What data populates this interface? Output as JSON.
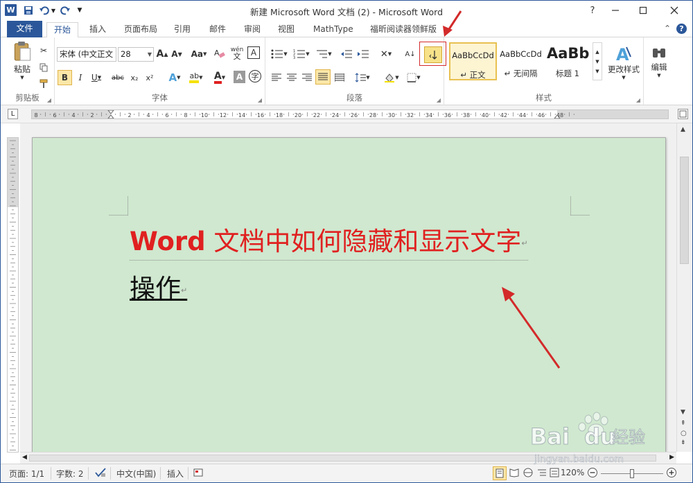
{
  "window": {
    "title": "新建 Microsoft Word 文档 (2)  -  Microsoft Word",
    "app_icon": "W"
  },
  "ribbon_tabs": [
    {
      "label": "文件"
    },
    {
      "label": "开始"
    },
    {
      "label": "插入"
    },
    {
      "label": "页面布局"
    },
    {
      "label": "引用"
    },
    {
      "label": "邮件"
    },
    {
      "label": "审阅"
    },
    {
      "label": "视图"
    },
    {
      "label": "MathType"
    },
    {
      "label": "福昕阅读器领鲜版"
    }
  ],
  "groups": {
    "clipboard": {
      "label": "剪贴板",
      "paste": "粘贴"
    },
    "font": {
      "label": "字体",
      "font_name": "宋体 (中文正文",
      "font_size": "28",
      "bold": "B",
      "italic": "I",
      "underline": "U",
      "strike": "abc",
      "subscript": "x₂",
      "superscript": "x²",
      "grow": "A",
      "shrink": "A",
      "change_case": "Aa",
      "wen": "文",
      "phonetic": "wén",
      "border_char": "A",
      "font_color": "A",
      "char_shade": "A",
      "enclose": "字"
    },
    "paragraph": {
      "label": "段落"
    },
    "styles": {
      "label": "样式",
      "items": [
        {
          "sample": "AaBbCcDd",
          "name": "↵ 正文"
        },
        {
          "sample": "AaBbCcDd",
          "name": "↵ 无间隔"
        },
        {
          "sample": "AaBb",
          "name": "标题 1"
        }
      ],
      "change_styles": "更改样式"
    },
    "editing": {
      "label": "编辑"
    }
  },
  "document": {
    "line1_word": "Word",
    "line1_rest": " 文档中如何隐藏和显示文字",
    "line2": "操作",
    "paragraph_mark": "↵"
  },
  "ruler_numbers": [
    "8",
    "6",
    "4",
    "2",
    "",
    "2",
    "4",
    "6",
    "8",
    "10",
    "12",
    "14",
    "16",
    "18",
    "20",
    "22",
    "24",
    "26",
    "28",
    "30",
    "32",
    "34",
    "36",
    "38",
    "40",
    "42",
    "44",
    "46",
    "48"
  ],
  "status": {
    "page": "页面: 1/1",
    "words": "字数: 2",
    "language": "中文(中国)",
    "mode": "插入",
    "zoom": "120%"
  },
  "watermark": {
    "brand": "Bai",
    "brand2": "du",
    "cn": "经验",
    "url": "jingyan.baidu.com"
  },
  "colors": {
    "accent": "#2b579a",
    "page_bg": "#cfe8cf",
    "title_text": "#e02020",
    "annotation": "#d32a2a"
  }
}
